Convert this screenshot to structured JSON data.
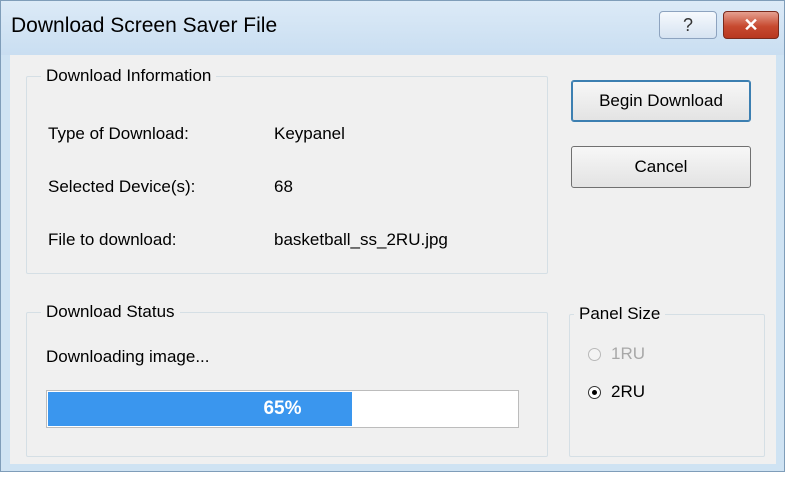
{
  "window": {
    "title": "Download Screen Saver File",
    "help_icon": "?",
    "close_icon": "✕"
  },
  "download_info": {
    "legend": "Download Information",
    "rows": [
      {
        "label": "Type of Download:",
        "value": "Keypanel"
      },
      {
        "label": "Selected Device(s):",
        "value": "68"
      },
      {
        "label": "File to download:",
        "value": "basketball_ss_2RU.jpg"
      }
    ]
  },
  "buttons": {
    "begin": "Begin Download",
    "cancel": "Cancel"
  },
  "download_status": {
    "legend": "Download Status",
    "message": "Downloading image...",
    "progress_percent": 65,
    "progress_label": "65%"
  },
  "panel_size": {
    "legend": "Panel Size",
    "options": [
      {
        "label": "1RU",
        "checked": false,
        "disabled": true
      },
      {
        "label": "2RU",
        "checked": true,
        "disabled": false
      }
    ]
  }
}
